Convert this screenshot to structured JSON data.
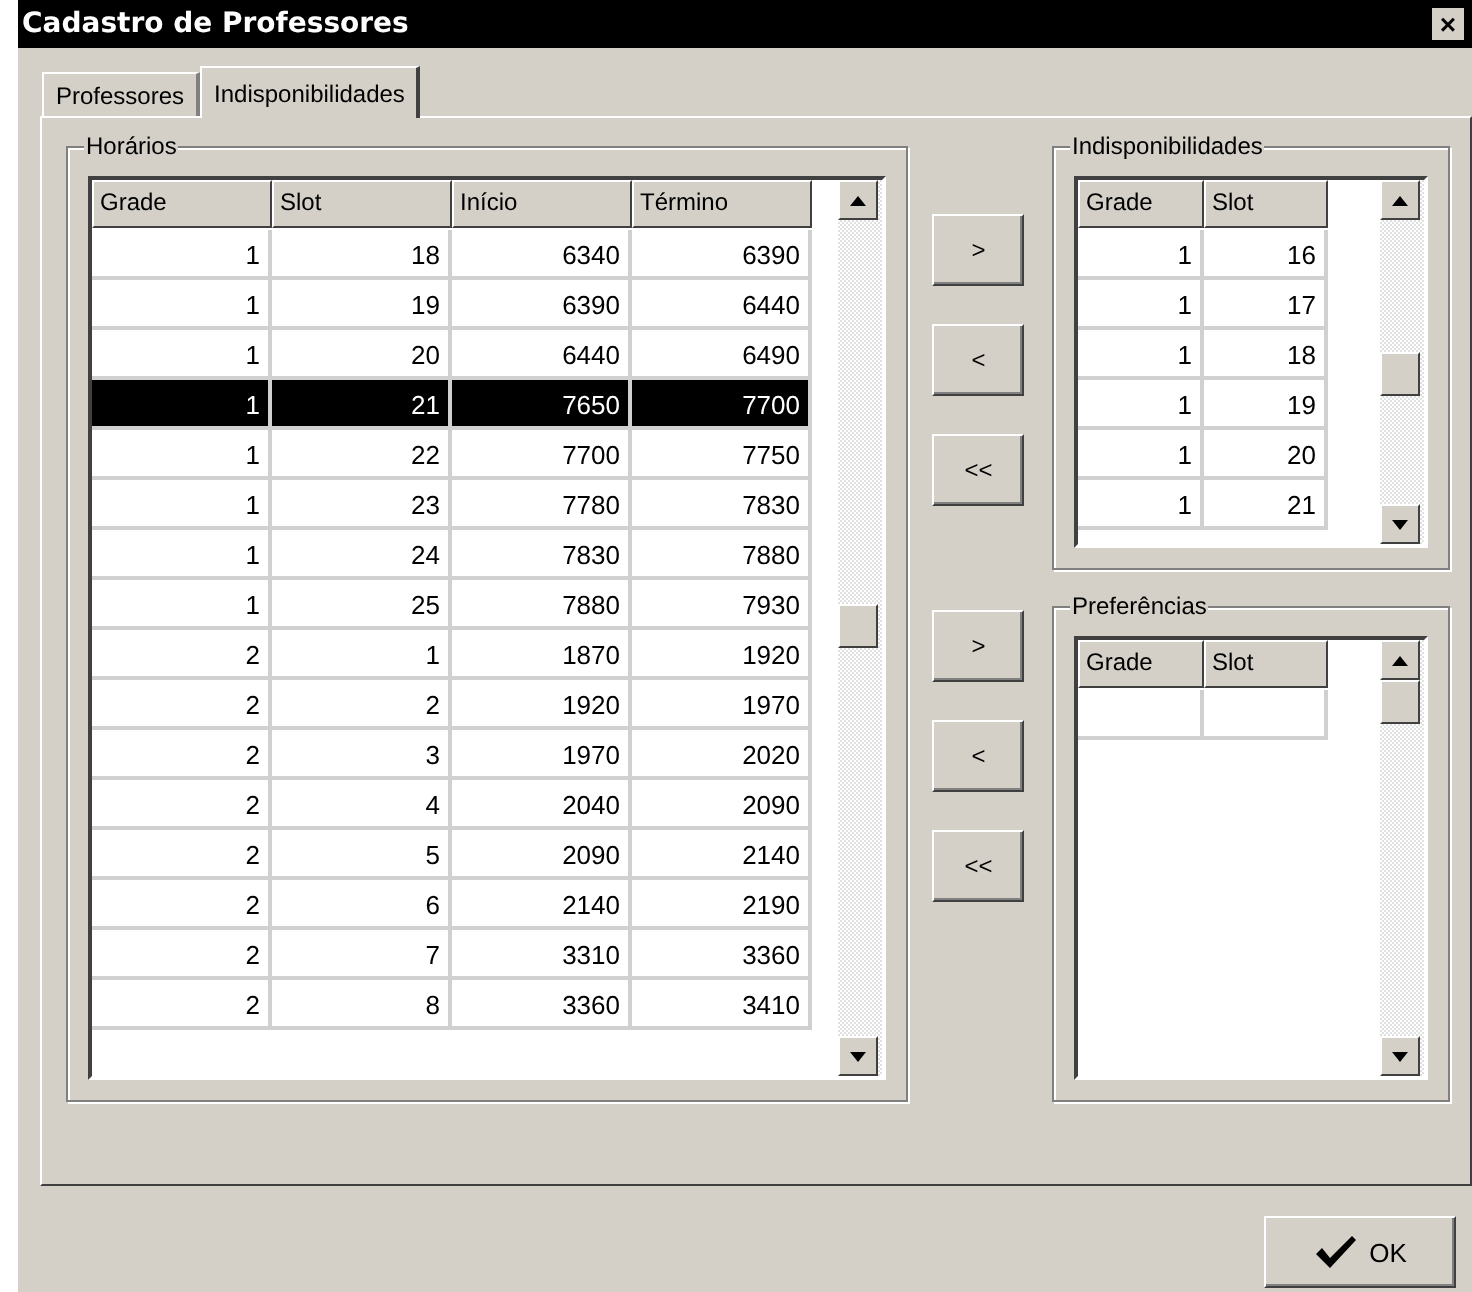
{
  "window": {
    "title": "Cadastro de Professores",
    "close": "×"
  },
  "tabs": [
    {
      "label": "Professores",
      "selected": false
    },
    {
      "label": "Indisponibilidades",
      "selected": true
    }
  ],
  "horarios": {
    "title": "Horários",
    "columns": [
      "Grade",
      "Slot",
      "Início",
      "Término"
    ],
    "rows": [
      {
        "cells": [
          "1",
          "18",
          "6340",
          "6390"
        ],
        "selected": false
      },
      {
        "cells": [
          "1",
          "19",
          "6390",
          "6440"
        ],
        "selected": false
      },
      {
        "cells": [
          "1",
          "20",
          "6440",
          "6490"
        ],
        "selected": false
      },
      {
        "cells": [
          "1",
          "21",
          "7650",
          "7700"
        ],
        "selected": true
      },
      {
        "cells": [
          "1",
          "22",
          "7700",
          "7750"
        ],
        "selected": false
      },
      {
        "cells": [
          "1",
          "23",
          "7780",
          "7830"
        ],
        "selected": false
      },
      {
        "cells": [
          "1",
          "24",
          "7830",
          "7880"
        ],
        "selected": false
      },
      {
        "cells": [
          "1",
          "25",
          "7880",
          "7930"
        ],
        "selected": false
      },
      {
        "cells": [
          "2",
          "1",
          "1870",
          "1920"
        ],
        "selected": false
      },
      {
        "cells": [
          "2",
          "2",
          "1920",
          "1970"
        ],
        "selected": false
      },
      {
        "cells": [
          "2",
          "3",
          "1970",
          "2020"
        ],
        "selected": false
      },
      {
        "cells": [
          "2",
          "4",
          "2040",
          "2090"
        ],
        "selected": false
      },
      {
        "cells": [
          "2",
          "5",
          "2090",
          "2140"
        ],
        "selected": false
      },
      {
        "cells": [
          "2",
          "6",
          "2140",
          "2190"
        ],
        "selected": false
      },
      {
        "cells": [
          "2",
          "7",
          "3310",
          "3360"
        ],
        "selected": false
      },
      {
        "cells": [
          "2",
          "8",
          "3360",
          "3410"
        ],
        "selected": false
      }
    ]
  },
  "indisponibilidades_buttons": [
    ">",
    "<",
    "<<"
  ],
  "indisponibilidades": {
    "title": "Indisponibilidades",
    "columns": [
      "Grade",
      "Slot"
    ],
    "rows": [
      {
        "cells": [
          "1",
          "16"
        ],
        "selected": false
      },
      {
        "cells": [
          "1",
          "17"
        ],
        "selected": false
      },
      {
        "cells": [
          "1",
          "18"
        ],
        "selected": false
      },
      {
        "cells": [
          "1",
          "19"
        ],
        "selected": false
      },
      {
        "cells": [
          "1",
          "20"
        ],
        "selected": false
      },
      {
        "cells": [
          "1",
          "21"
        ],
        "selected": false
      }
    ]
  },
  "preferencias_buttons": [
    ">",
    "<",
    "<<"
  ],
  "preferencias": {
    "title": "Preferências",
    "columns": [
      "Grade",
      "Slot"
    ]
  },
  "ok_button": "OK"
}
